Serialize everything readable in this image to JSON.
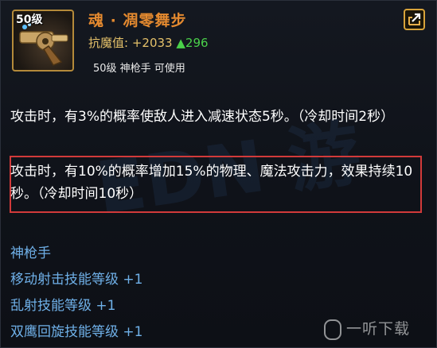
{
  "item": {
    "level_tag": "50级",
    "name": "魂 · 凋零舞步",
    "stat_label": "抗魔值:",
    "stat_value": "+2033",
    "stat_increase": "▲296",
    "requirement": "50级  神枪手  可使用"
  },
  "effects": {
    "line1": "攻击时，有3%的概率使敌人进入减速状态5秒。（冷却时间2秒）",
    "line2": "攻击时，有10%的概率增加15%的物理、魔法攻击力，效果持续10秒。（冷却时间10秒）"
  },
  "bonus": {
    "class_name": "神枪手",
    "items": [
      "移动射击技能等级 +1",
      "乱射技能等级 +1",
      "双鹰回旋技能等级 +1"
    ]
  },
  "watermark": "一听下载",
  "colors": {
    "title": "#e58a2f",
    "stat": "#e5c16a",
    "increase": "#4ad04a",
    "bonus": "#6fb0e8",
    "highlight_border": "#d23a3a"
  },
  "icons": [
    "revolver-item-icon",
    "share-icon",
    "watermark-logo-icon"
  ]
}
